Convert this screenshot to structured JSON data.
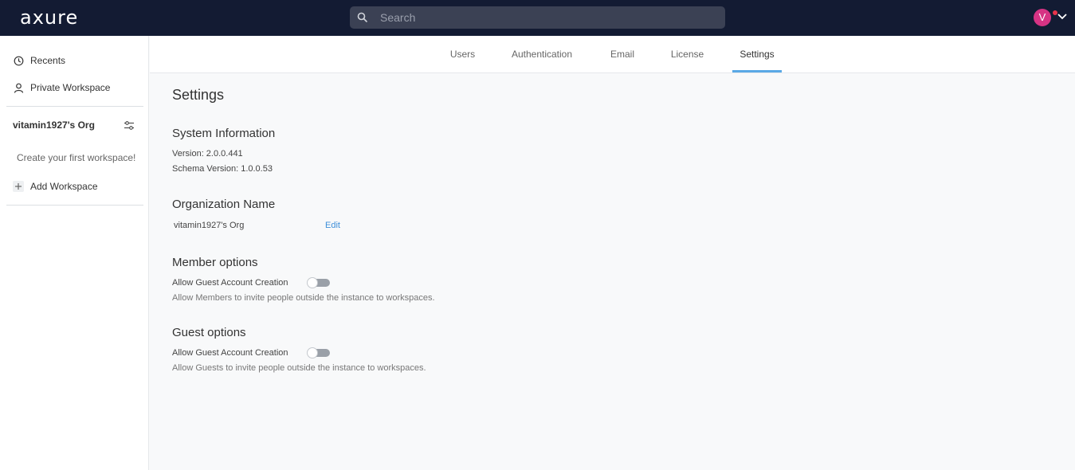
{
  "topbar": {
    "logo": "axure",
    "search_placeholder": "Search",
    "avatar_initial": "V"
  },
  "sidebar": {
    "items": [
      {
        "label": "Recents",
        "icon": "clock-icon"
      },
      {
        "label": "Private Workspace",
        "icon": "user-icon"
      }
    ],
    "org_name": "vitamin1927's Org",
    "create_workspace_hint": "Create your first workspace!",
    "add_workspace_label": "Add Workspace"
  },
  "tabs": [
    {
      "label": "Users",
      "active": false
    },
    {
      "label": "Authentication",
      "active": false
    },
    {
      "label": "Email",
      "active": false
    },
    {
      "label": "License",
      "active": false
    },
    {
      "label": "Settings",
      "active": true
    }
  ],
  "settings": {
    "title": "Settings",
    "system_info": {
      "heading": "System Information",
      "version": "Version: 2.0.0.441",
      "schema_version": "Schema Version: 1.0.0.53"
    },
    "organization": {
      "heading": "Organization Name",
      "name": "vitamin1927's Org",
      "edit_label": "Edit"
    },
    "member_options": {
      "heading": "Member options",
      "toggle_label": "Allow Guest Account Creation",
      "toggle_on": false,
      "description": "Allow Members to invite people outside the instance to workspaces."
    },
    "guest_options": {
      "heading": "Guest options",
      "toggle_label": "Allow Guest Account Creation",
      "toggle_on": false,
      "description": "Allow Guests to invite people outside the instance to workspaces."
    }
  },
  "colors": {
    "topbar_bg": "#131b33",
    "accent": "#5aa9e6",
    "link": "#3e8fd9",
    "avatar": "#d63384"
  }
}
